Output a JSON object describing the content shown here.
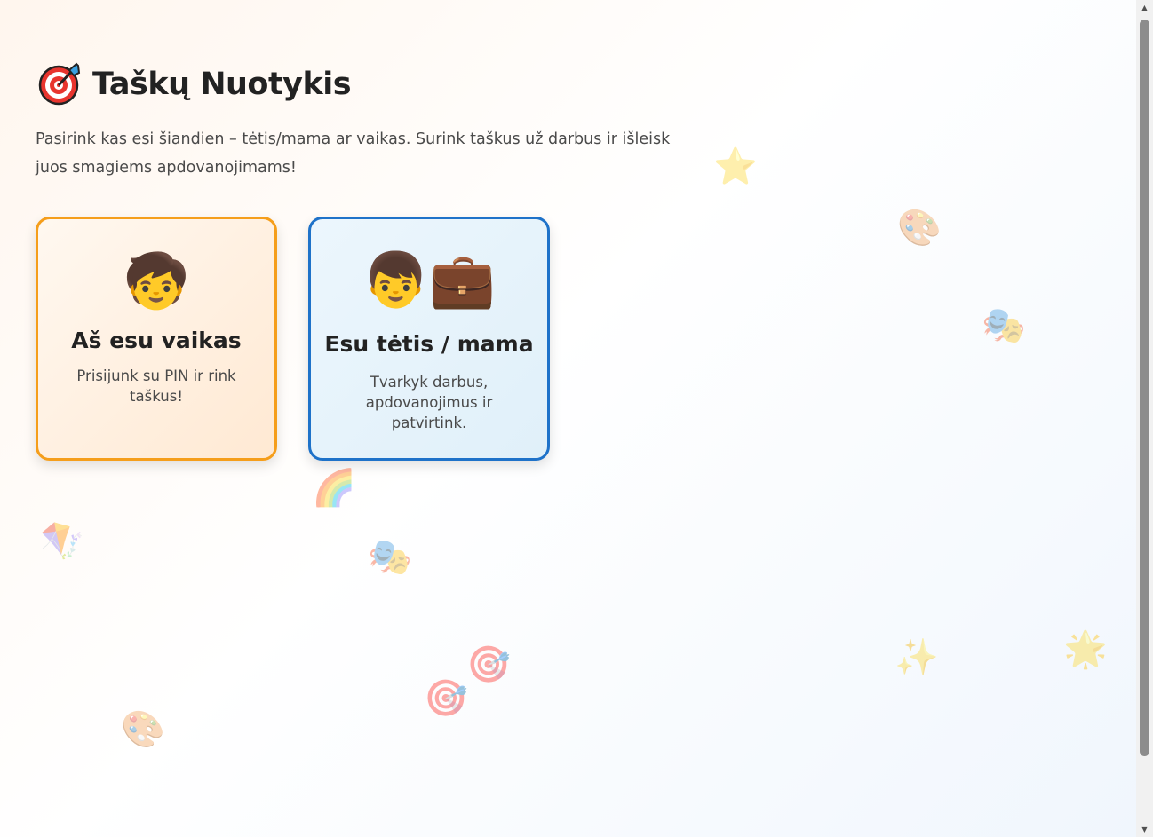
{
  "header": {
    "title_icon": "🎯",
    "title": "Taškų Nuotykis",
    "subtitle": "Pasirink kas esi šiandien – tėtis/mama ar vaikas. Surink taškus už darbus ir išleisk juos smagiems apdovanojimams!"
  },
  "cards": {
    "kid": {
      "emoji": "🧒",
      "title": "Aš esu vaikas",
      "description": "Prisijunk su PIN ir rink taškus!",
      "border_color": "#f59e1b"
    },
    "parent": {
      "emoji": "👦💼",
      "title": "Esu tėtis / mama",
      "description": "Tvarkyk darbus, apdovanojimus ir patvirtink.",
      "border_color": "#1e72c9"
    }
  },
  "decorations": {
    "star": "⭐",
    "palette": "🎨",
    "masks": "🎭",
    "rainbow": "🌈",
    "kite": "🪁",
    "target": "🎯",
    "sparkles": "✨",
    "glowing_star": "🌟"
  },
  "scrollbar": {
    "thumb_fraction": 0.88
  }
}
